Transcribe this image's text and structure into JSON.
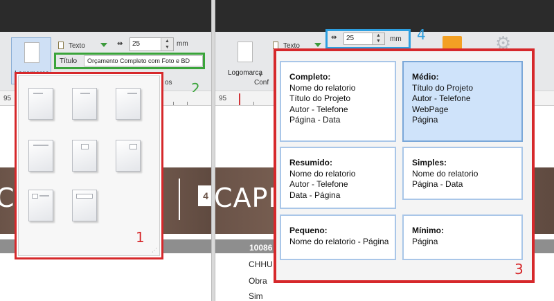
{
  "left": {
    "ribbon": {
      "logo_label": "Logomarca",
      "text_label": "Texto",
      "size_value": "25",
      "size_unit": "mm",
      "titulo_label": "Título",
      "titulo_value": "Orçamento Completo com Foto e BD",
      "group_fragment": "os"
    },
    "ruler_label": "95",
    "badges": {
      "green": "2",
      "red": "1"
    },
    "banner_text": "C"
  },
  "right": {
    "ribbon": {
      "logo_label": "Logomarca",
      "text_label": "Texto",
      "size_value": "25",
      "size_unit": "mm",
      "group_fragment": "Conf"
    },
    "ruler_label": "95",
    "badges": {
      "blue": "4",
      "red": "3"
    },
    "banner_text": "CAPE",
    "doc_rows": [
      "10086",
      "CHHU",
      "Obra",
      "Sim"
    ],
    "cards": [
      {
        "title": "Completo:",
        "lines": [
          "Nome do relatorio",
          "Título do Projeto",
          "Autor - Telefone",
          "Página - Data"
        ],
        "selected": false
      },
      {
        "title": "Médio:",
        "lines": [
          "Título do Projeto",
          "Autor - Telefone",
          "WebPage",
          "Página"
        ],
        "selected": true
      },
      {
        "title": "Resumido:",
        "lines": [
          "Nome do relatorio",
          "Autor - Telefone",
          "Data - Página"
        ],
        "selected": false
      },
      {
        "title": "Simples:",
        "lines": [
          "Nome do relatorio",
          "Página - Data"
        ],
        "selected": false
      },
      {
        "title": "Pequeno:",
        "lines": [
          "Nome do relatorio - Página"
        ],
        "selected": false
      },
      {
        "title": "Mínimo:",
        "lines": [
          "Página"
        ],
        "selected": false
      }
    ]
  },
  "colors": {
    "annotation_red": "#d6282b",
    "annotation_green": "#3aa43a",
    "annotation_blue": "#2d9fe0",
    "selection_blue": "#cfe3fa"
  }
}
